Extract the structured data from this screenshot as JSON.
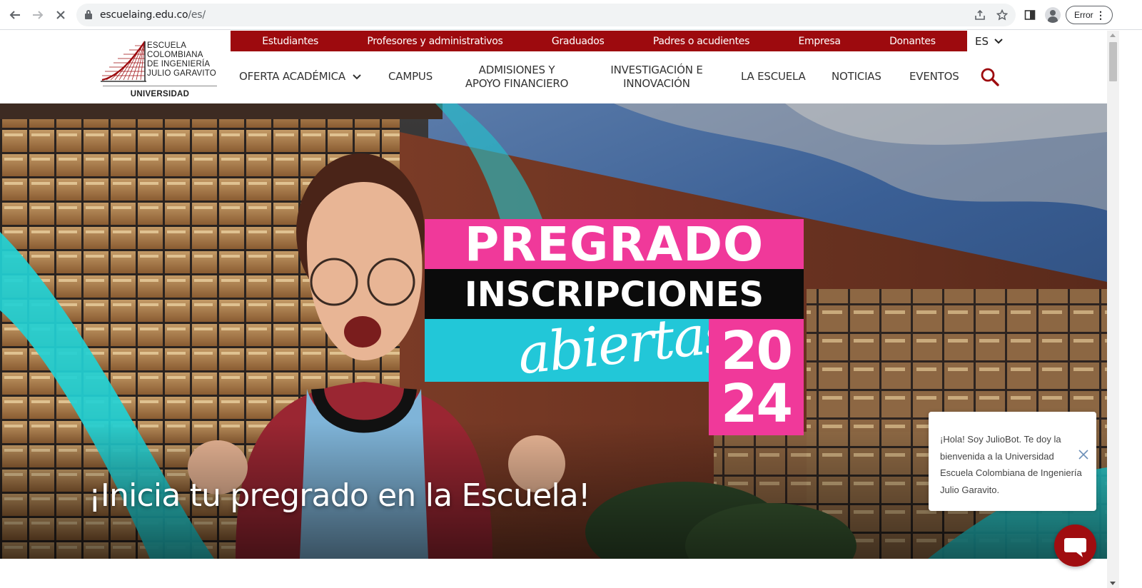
{
  "browser": {
    "url_host": "escuelaing.edu.co",
    "url_path": "/es/",
    "profile_status": "Error"
  },
  "site": {
    "logo": {
      "line1": "Escuela",
      "line2": "Colombiana",
      "line3": "de Ingeniería",
      "line4": "Julio Garavito",
      "sub": "UNIVERSIDAD"
    },
    "topbar": [
      {
        "label": "Estudiantes"
      },
      {
        "label": "Profesores y administrativos"
      },
      {
        "label": "Graduados"
      },
      {
        "label": "Padres o acudientes"
      },
      {
        "label": "Empresa"
      },
      {
        "label": "Donantes"
      }
    ],
    "language": "ES",
    "mainnav": {
      "oferta": "OFERTA ACADÉMICA",
      "campus": "CAMPUS",
      "admisiones_1": "ADMISIONES Y",
      "admisiones_2": "APOYO FINANCIERO",
      "investigacion_1": "INVESTIGACIÓN E",
      "investigacion_2": "INNOVACIÓN",
      "escuela": "LA ESCUELA",
      "noticias": "NOTICIAS",
      "eventos": "EVENTOS"
    }
  },
  "hero": {
    "promo_line1": "PREGRADO",
    "promo_line2": "INSCRIPCIONES",
    "promo_script": "abiertas",
    "promo_year_top": "20",
    "promo_year_bottom": "24",
    "caption": "¡Inicia tu pregrado en la Escuela!"
  },
  "chat": {
    "message": "¡Hola! Soy JulioBot. Te doy la bienvenida a la Universidad Escuela Colombiana de Ingeniería Julio Garavito."
  },
  "colors": {
    "brand_red": "#9d0a0e",
    "promo_pink": "#f0399a",
    "promo_cyan": "#22c7d8"
  }
}
